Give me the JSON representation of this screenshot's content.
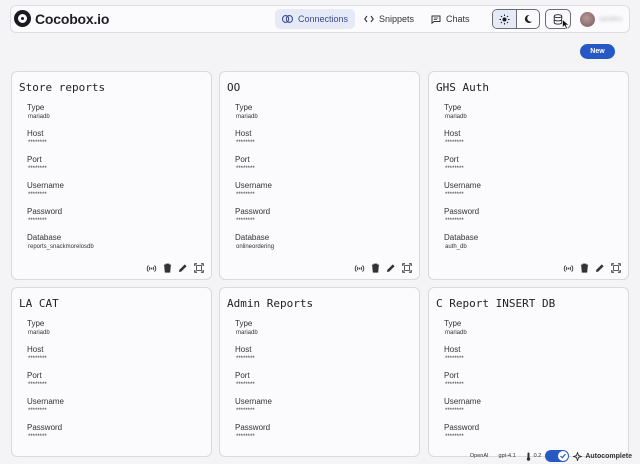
{
  "header": {
    "logo_text": "Cocobox.io",
    "nav": [
      {
        "label": "Connections",
        "active": true
      },
      {
        "label": "Snippets",
        "active": false
      },
      {
        "label": "Chats",
        "active": false
      }
    ],
    "user_name": "sandeo"
  },
  "new_button_label": "New",
  "field_labels": {
    "type": "Type",
    "host": "Host",
    "port": "Port",
    "username": "Username",
    "password": "Password",
    "database": "Database"
  },
  "connections": [
    {
      "name": "Store reports",
      "type": "mariadb",
      "host": "********",
      "port": "********",
      "username": "********",
      "password": "********",
      "database": "reports_snackmorelosdb"
    },
    {
      "name": "OO",
      "type": "mariadb",
      "host": "********",
      "port": "********",
      "username": "********",
      "password": "********",
      "database": "onlineordering"
    },
    {
      "name": "GHS Auth",
      "type": "mariadb",
      "host": "********",
      "port": "********",
      "username": "********",
      "password": "********",
      "database": "auth_db"
    },
    {
      "name": "LA CAT",
      "type": "mariadb",
      "host": "********",
      "port": "********",
      "username": "********",
      "password": "********"
    },
    {
      "name": "Admin Reports",
      "type": "mariadb",
      "host": "********",
      "port": "********",
      "username": "********",
      "password": "********"
    },
    {
      "name": "C Report INSERT DB",
      "type": "mariadb",
      "host": "********",
      "port": "********",
      "username": "********",
      "password": "********"
    }
  ],
  "statusbar": {
    "provider": "OpenAI",
    "model": "gpt-4.1",
    "temperature": "0.2",
    "autocomplete_label": "Autocomplete",
    "autocomplete_on": true
  },
  "colors": {
    "accent": "#2659c4",
    "active_nav_bg": "#e6e9f6",
    "page_bg": "#f4f4f7"
  },
  "icons": [
    "logo-icon",
    "link-icon",
    "code-icon",
    "chat-icon",
    "sun-icon",
    "moon-icon",
    "database-icon",
    "signal-icon",
    "trash-icon",
    "pencil-icon",
    "expand-icon",
    "thermometer-icon",
    "check-icon",
    "sparkle-icon"
  ]
}
